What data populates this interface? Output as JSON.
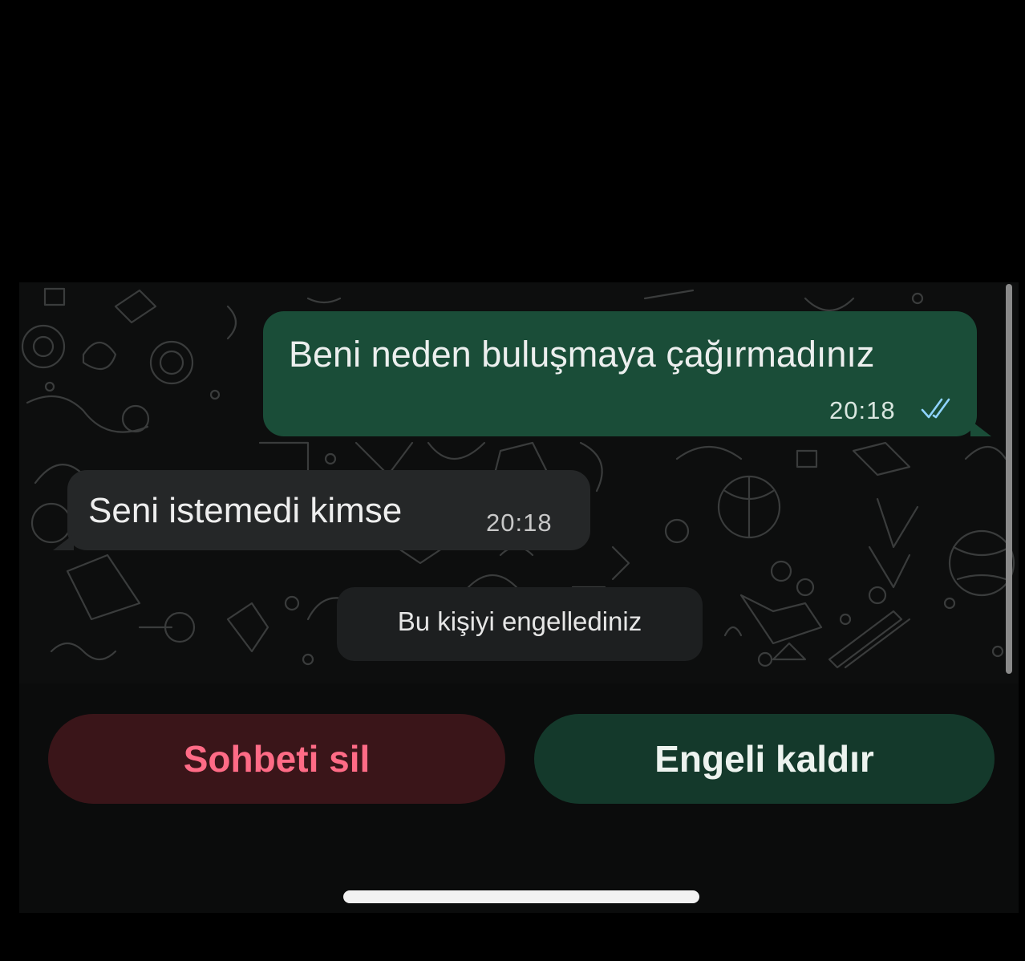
{
  "messages": {
    "outgoing": {
      "text": "Beni neden buluşmaya çağırmadınız",
      "time": "20:18",
      "status": "read-double-check-icon"
    },
    "incoming": {
      "text": "Seni istemedi kimse",
      "time": "20:18"
    }
  },
  "system_notice": "Bu kişiyi engellediniz",
  "actions": {
    "delete_chat": "Sohbeti sil",
    "unblock": "Engeli kaldır"
  },
  "colors": {
    "outgoing_bubble": "#1a4d38",
    "incoming_bubble": "#252728",
    "delete_text": "#ff6b86",
    "unblock_bg": "#14392b",
    "read_ticks": "#8fd3ff"
  }
}
